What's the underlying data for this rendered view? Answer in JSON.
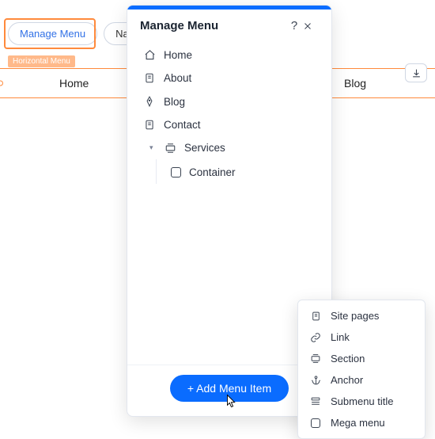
{
  "toolbar": {
    "manage_menu_label": "Manage Menu",
    "navigate_label": "Na"
  },
  "canvas": {
    "badge": "Horizontal Menu",
    "items": [
      "Home",
      "Blog"
    ]
  },
  "panel": {
    "title": "Manage Menu",
    "items": [
      {
        "icon": "home",
        "label": "Home"
      },
      {
        "icon": "page",
        "label": "About"
      },
      {
        "icon": "pen",
        "label": "Blog"
      },
      {
        "icon": "page",
        "label": "Contact"
      },
      {
        "icon": "section",
        "label": "Services",
        "expanded": true,
        "children": [
          {
            "icon": "square",
            "label": "Container"
          }
        ]
      }
    ],
    "add_button": "+ Add Menu Item"
  },
  "flyout": {
    "options": [
      {
        "icon": "page",
        "label": "Site pages"
      },
      {
        "icon": "link",
        "label": "Link"
      },
      {
        "icon": "section",
        "label": "Section"
      },
      {
        "icon": "anchor",
        "label": "Anchor"
      },
      {
        "icon": "subtitle",
        "label": "Submenu title"
      },
      {
        "icon": "square",
        "label": "Mega menu"
      }
    ]
  }
}
